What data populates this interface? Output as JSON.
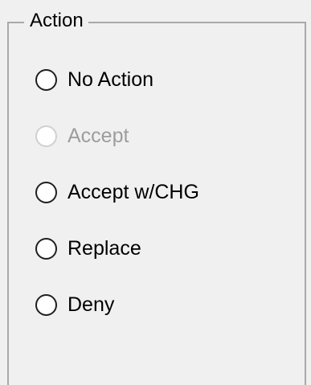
{
  "action_group": {
    "title": "Action",
    "options": [
      {
        "label": "No Action",
        "selected": false,
        "enabled": true
      },
      {
        "label": "Accept",
        "selected": false,
        "enabled": false
      },
      {
        "label": "Accept w/CHG",
        "selected": false,
        "enabled": true
      },
      {
        "label": "Replace",
        "selected": false,
        "enabled": true
      },
      {
        "label": "Deny",
        "selected": false,
        "enabled": true
      }
    ]
  }
}
